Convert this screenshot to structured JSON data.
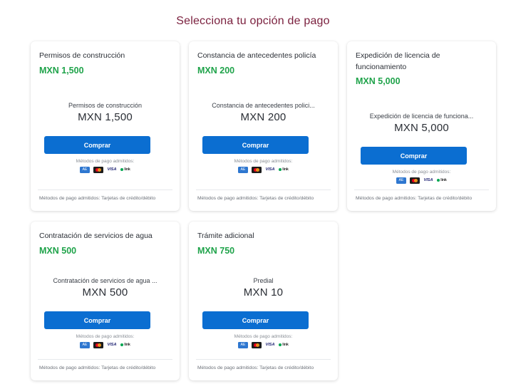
{
  "page": {
    "title": "Selecciona tu opción de pago"
  },
  "common": {
    "buy_label": "Comprar",
    "methods_label": "Métodos de pago admitidos:",
    "footer": "Métodos de pago admitidos: Tarjetas de crédito/débito",
    "payment_icons": [
      "amex-icon",
      "mastercard-icon",
      "visa-icon",
      "link-icon"
    ],
    "payment_icon_text": {
      "amex": "AE",
      "visa": "VISA",
      "link": "link"
    }
  },
  "colors": {
    "title": "#7a1f3d",
    "price": "#1fa34a",
    "button": "#0b6ed1"
  },
  "cards": [
    {
      "title": "Permisos de construcción",
      "price": "MXN 1,500",
      "widget_name": "Permisos de construcción",
      "widget_amount": "MXN 1,500"
    },
    {
      "title": "Constancia de antecedentes policía",
      "price": "MXN 200",
      "widget_name": "Constancia de antecedentes polici...",
      "widget_amount": "MXN 200"
    },
    {
      "title": "Expedición de licencia de funcionamiento",
      "price": "MXN 5,000",
      "widget_name": "Expedición de licencia de funciona...",
      "widget_amount": "MXN 5,000"
    },
    {
      "title": "Contratación de servicios de agua",
      "price": "MXN 500",
      "widget_name": "Contratación de servicios de agua ...",
      "widget_amount": "MXN 500"
    },
    {
      "title": "Trámite adicional",
      "price": "MXN 750",
      "widget_name": "Predial",
      "widget_amount": "MXN 10"
    }
  ]
}
